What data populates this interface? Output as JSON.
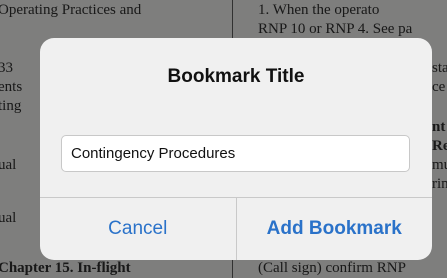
{
  "document": {
    "left_lines": [
      "Operating Practices and",
      "33",
      "ents",
      "ting",
      "ual",
      "ual",
      "Chapter 15. In-flight"
    ],
    "right_lines": [
      "1. When the operato",
      "RNP 10 or RNP 4. See pa",
      "stat",
      "ce v",
      "nt",
      "Req",
      "mus",
      "ring",
      "(Call sign) confirm RNP"
    ]
  },
  "dialog": {
    "title": "Bookmark Title",
    "input_value": "Contingency Procedures",
    "cancel_label": "Cancel",
    "add_label": "Add Bookmark"
  },
  "colors": {
    "accent": "#2a72c9"
  }
}
